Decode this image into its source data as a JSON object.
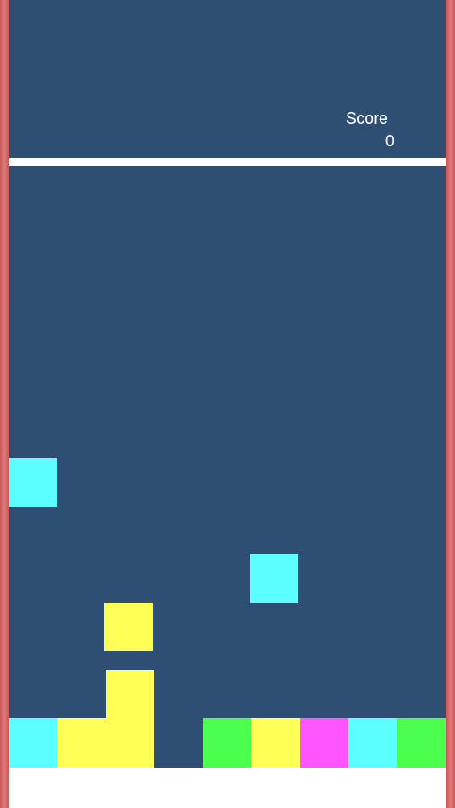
{
  "hud": {
    "score_label": "Score",
    "score_value": "0"
  },
  "colors": {
    "background": "#2f4e73",
    "wall": "#d06464",
    "divider": "#ffffff",
    "cyan": "#5cffff",
    "yellow": "#ffff55",
    "green": "#4cff4c",
    "magenta": "#ff55ff"
  },
  "board": {
    "blocks": [
      {
        "name": "cyan-block-floating-left",
        "color": "cyan"
      },
      {
        "name": "cyan-block-floating-mid",
        "color": "cyan"
      },
      {
        "name": "yellow-block-floating",
        "color": "yellow"
      },
      {
        "name": "yellow-block-column-top",
        "color": "yellow"
      },
      {
        "name": "bottom-row-cell-1",
        "color": "cyan"
      },
      {
        "name": "bottom-row-cell-2",
        "color": "yellow"
      },
      {
        "name": "bottom-row-cell-3",
        "color": "yellow"
      },
      {
        "name": "bottom-row-cell-5",
        "color": "green"
      },
      {
        "name": "bottom-row-cell-6",
        "color": "yellow"
      },
      {
        "name": "bottom-row-cell-7",
        "color": "magenta"
      },
      {
        "name": "bottom-row-cell-8",
        "color": "cyan"
      },
      {
        "name": "bottom-row-cell-9",
        "color": "green"
      }
    ]
  }
}
